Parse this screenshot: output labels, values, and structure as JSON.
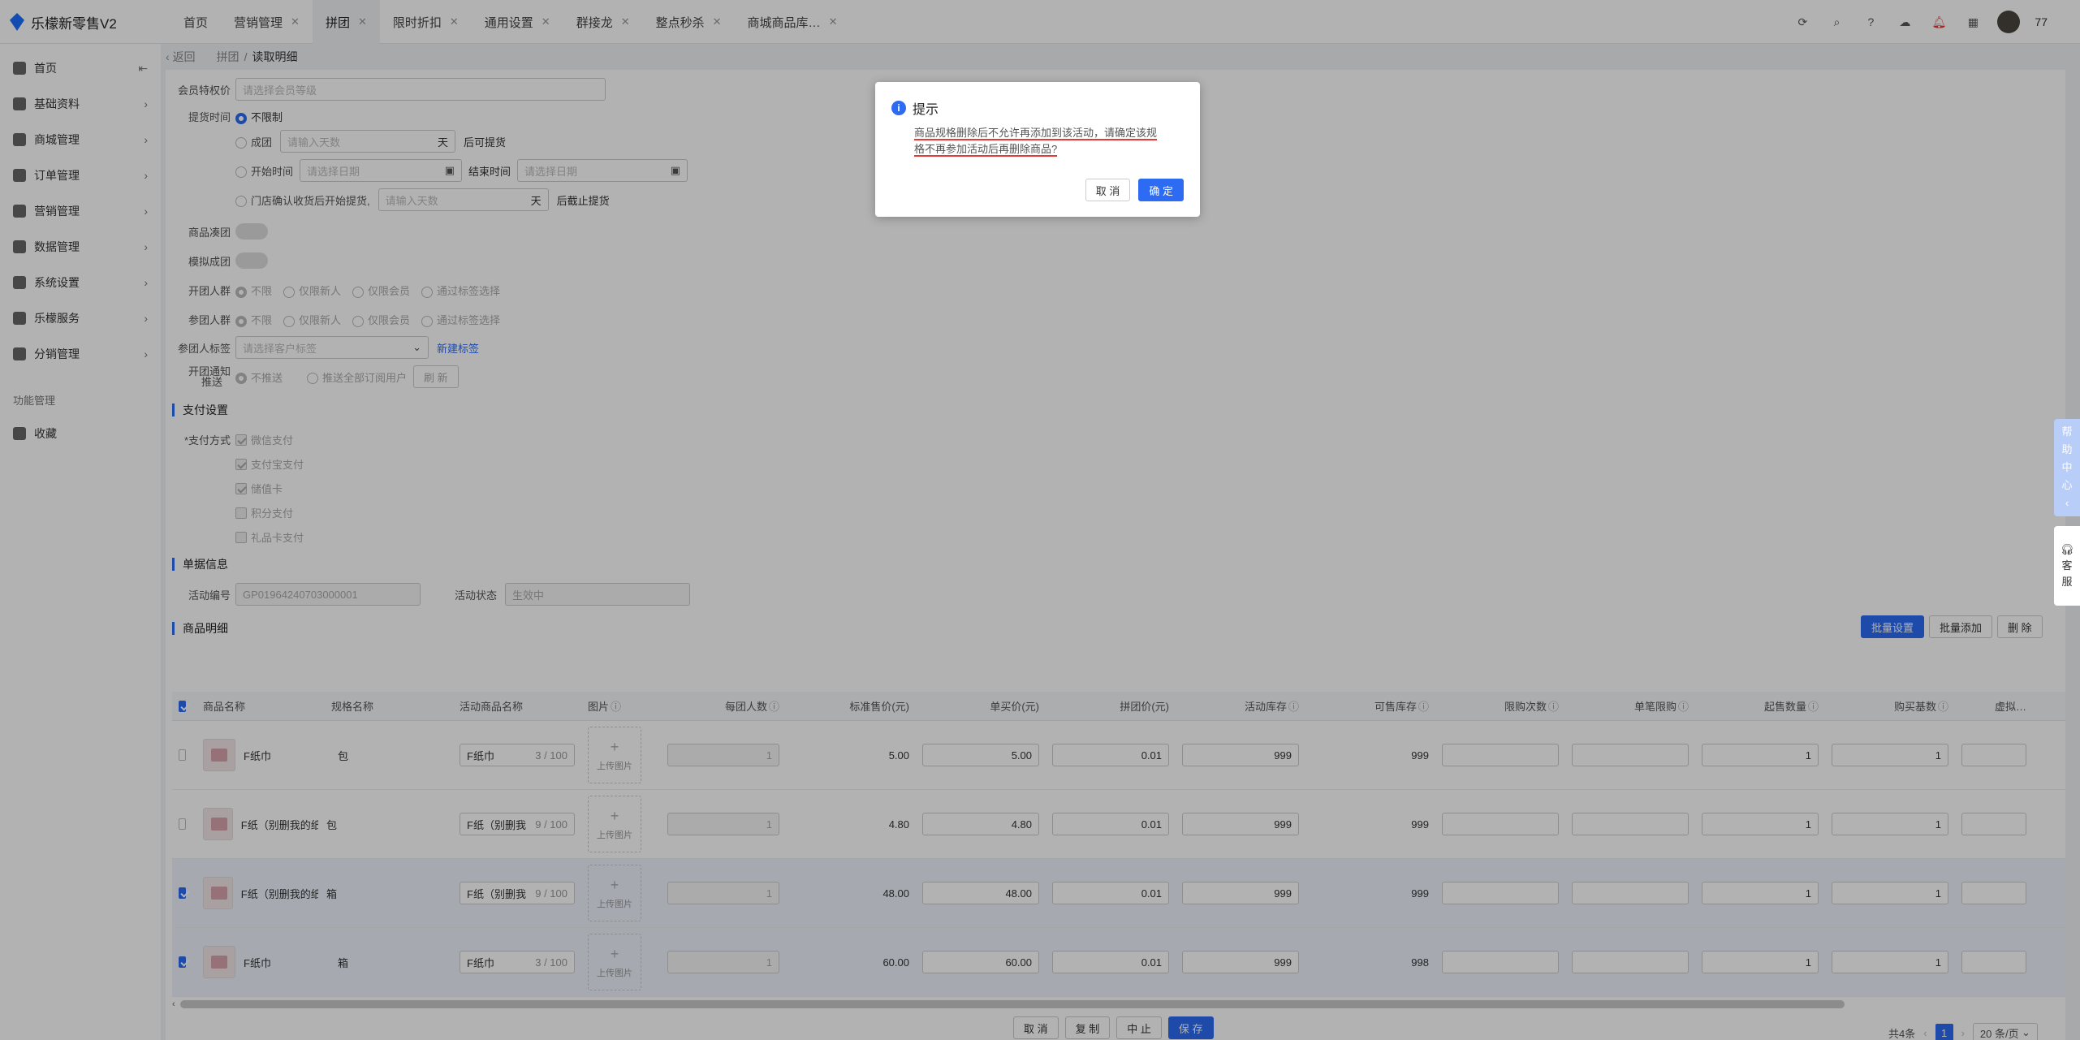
{
  "app": {
    "title": "乐檬新零售V2"
  },
  "tabs": [
    {
      "label": "首页",
      "closable": false,
      "active": false
    },
    {
      "label": "营销管理",
      "closable": true,
      "active": false
    },
    {
      "label": "拼团",
      "closable": true,
      "active": true
    },
    {
      "label": "限时折扣",
      "closable": true,
      "active": false
    },
    {
      "label": "通用设置",
      "closable": true,
      "active": false
    },
    {
      "label": "群接龙",
      "closable": true,
      "active": false
    },
    {
      "label": "整点秒杀",
      "closable": true,
      "active": false
    },
    {
      "label": "商城商品库…",
      "closable": true,
      "active": false
    }
  ],
  "toolbar": {
    "username": "77",
    "icons": [
      "refresh-icon",
      "search-icon",
      "help-icon",
      "cloud-download-icon",
      "bell-icon",
      "apps-grid-icon"
    ]
  },
  "sidebar": {
    "items": [
      {
        "label": "首页",
        "icon": "home-icon",
        "chevron": "collapse"
      },
      {
        "label": "基础资料",
        "icon": "database-icon"
      },
      {
        "label": "商城管理",
        "icon": "shop-icon"
      },
      {
        "label": "订单管理",
        "icon": "order-icon"
      },
      {
        "label": "营销管理",
        "icon": "marketing-icon"
      },
      {
        "label": "数据管理",
        "icon": "chart-icon"
      },
      {
        "label": "系统设置",
        "icon": "settings-icon"
      },
      {
        "label": "乐檬服务",
        "icon": "service-icon"
      },
      {
        "label": "分销管理",
        "icon": "distribution-icon"
      }
    ],
    "section_label": "功能管理",
    "favorites_label": "收藏"
  },
  "breadcrumb": {
    "back": "返回",
    "parent": "拼团",
    "current": "读取明细"
  },
  "form": {
    "member_price_label": "会员特权价",
    "member_price_placeholder": "请选择会员等级",
    "pickup_label": "提货时间",
    "pickup_unlimited": "不限制",
    "pickup_group": "成团",
    "pickup_days_placeholder": "请输入天数",
    "day_unit": "天",
    "pickup_after": "后可提货",
    "start_time": "开始时间",
    "start_placeholder": "请选择日期",
    "end_time": "结束时间",
    "end_placeholder": "请选择日期",
    "store_confirm": "门店确认收货后开始提货,",
    "store_days_placeholder": "请输入天数",
    "pickup_deadline": "后截止提货",
    "gather_label": "商品凑团",
    "simulate_label": "模拟成团",
    "open_group_label": "开团人群",
    "join_group_label": "参团人群",
    "audience_options": [
      "不限",
      "仅限新人",
      "仅限会员",
      "通过标签选择"
    ],
    "tag_label": "参团人标签",
    "tag_placeholder": "请选择客户标签",
    "new_tag": "新建标签",
    "notify_label_1": "开团通知",
    "notify_label_2": "推送",
    "notify_no": "不推送",
    "notify_all": "推送全部订阅用户",
    "refresh": "刷 新"
  },
  "payment": {
    "title": "支付设置",
    "method_label": "*支付方式",
    "methods": [
      {
        "label": "微信支付",
        "checked": true
      },
      {
        "label": "支付宝支付",
        "checked": true
      },
      {
        "label": "储值卡",
        "checked": true
      },
      {
        "label": "积分支付",
        "checked": false
      },
      {
        "label": "礼品卡支付",
        "checked": false
      }
    ]
  },
  "doc": {
    "title": "单据信息",
    "code_label": "活动编号",
    "code_value": "GP01964240703000001",
    "status_label": "活动状态",
    "status_value": "生效中"
  },
  "products": {
    "title": "商品明细",
    "batch_set": "批量设置",
    "batch_add": "批量添加",
    "delete": "删 除",
    "columns": [
      "商品名称",
      "规格名称",
      "活动商品名称",
      "图片",
      "每团人数",
      "标准售价(元)",
      "单买价(元)",
      "拼团价(元)",
      "活动库存",
      "可售库存",
      "限购次数",
      "单笔限购",
      "起售数量",
      "购买基数",
      "虚拟…"
    ],
    "upload_label": "上传图片",
    "rows": [
      {
        "selected": false,
        "name": "F纸巾",
        "spec": "包",
        "act_name": "F纸巾",
        "count": "3 / 100",
        "per_group": "1",
        "std_price": "5.00",
        "single_price": "5.00",
        "group_price": "0.01",
        "act_stock": "999",
        "avail_stock": "999",
        "limit_times": "",
        "single_limit": "",
        "min_qty": "1",
        "base": "1"
      },
      {
        "selected": false,
        "name": "F纸（别删我的纸",
        "spec": "包",
        "act_name": "F纸（别删我",
        "count": "9 / 100",
        "per_group": "1",
        "std_price": "4.80",
        "single_price": "4.80",
        "group_price": "0.01",
        "act_stock": "999",
        "avail_stock": "999",
        "limit_times": "",
        "single_limit": "",
        "min_qty": "1",
        "base": "1"
      },
      {
        "selected": true,
        "name": "F纸（别删我的纸",
        "spec": "箱",
        "act_name": "F纸（别删我",
        "count": "9 / 100",
        "per_group": "1",
        "std_price": "48.00",
        "single_price": "48.00",
        "group_price": "0.01",
        "act_stock": "999",
        "avail_stock": "999",
        "limit_times": "",
        "single_limit": "",
        "min_qty": "1",
        "base": "1"
      },
      {
        "selected": true,
        "name": "F纸巾",
        "spec": "箱",
        "act_name": "F纸巾",
        "count": "3 / 100",
        "per_group": "1",
        "std_price": "60.00",
        "single_price": "60.00",
        "group_price": "0.01",
        "act_stock": "999",
        "avail_stock": "998",
        "limit_times": "",
        "single_limit": "",
        "min_qty": "1",
        "base": "1"
      }
    ]
  },
  "pagination": {
    "total": "共4条",
    "page": "1",
    "page_size": "20 条/页"
  },
  "footer": {
    "cancel": "取 消",
    "copy": "复 制",
    "stop": "中 止",
    "save": "保 存"
  },
  "dialog": {
    "title": "提示",
    "message_line1": "商品规格删除后不允许再添加到该活动，请确定该规",
    "message_line2": "格不再参加活动后再删除商品?",
    "cancel": "取 消",
    "confirm": "确 定"
  },
  "float": {
    "help": [
      "帮",
      "助",
      "中",
      "心",
      "‹"
    ],
    "kefu": [
      "客",
      "服"
    ]
  },
  "colors": {
    "primary": "#2c6bf2",
    "underline": "#e53935"
  }
}
